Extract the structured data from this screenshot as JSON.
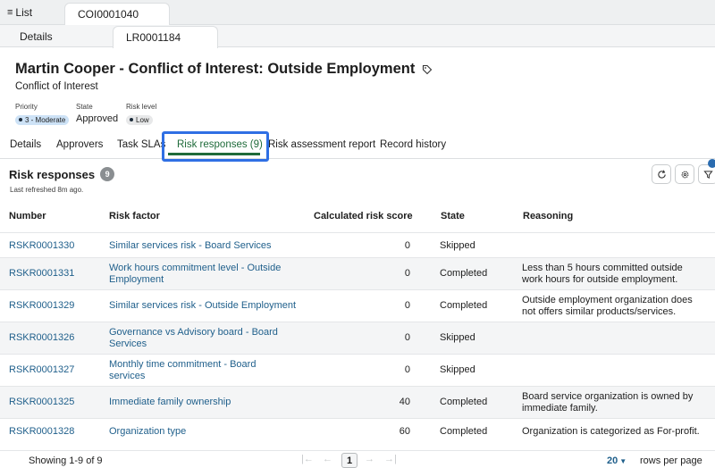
{
  "topbar": {
    "list_label": "List",
    "list_icon": "hamburger-icon",
    "record_tab": "COI0001040"
  },
  "subbar": {
    "details_tab": "Details",
    "record_tab": "LR0001184"
  },
  "header": {
    "title": "Martin Cooper - Conflict of Interest: Outside Employment",
    "subtitle": "Conflict of Interest",
    "fields": {
      "priority_label": "Priority",
      "priority_value": "3 - Moderate",
      "state_label": "State",
      "state_value": "Approved",
      "risk_label": "Risk level",
      "risk_value": "Low"
    }
  },
  "related_tabs": [
    "Details",
    "Approvers",
    "Task SLAs",
    "Risk responses (9)",
    "Risk assessment report",
    "Record history"
  ],
  "section": {
    "title": "Risk responses",
    "count": "9",
    "refreshed": "Last refreshed 8m ago."
  },
  "colors": {
    "link": "#1f5f8b",
    "active_tab": "#1f6b3a",
    "focus_ring": "#2f6fe4"
  },
  "table": {
    "headers": [
      "Number",
      "Risk factor",
      "Calculated risk score",
      "State",
      "Reasoning"
    ],
    "rows": [
      {
        "number": "RSKR0001330",
        "risk_factor": "Similar services risk - Board Services",
        "score": "0",
        "state": "Skipped",
        "reasoning": ""
      },
      {
        "number": "RSKR0001331",
        "risk_factor": "Work hours commitment level - Outside Employment",
        "score": "0",
        "state": "Completed",
        "reasoning": "Less than 5 hours committed outside work hours for outside employment."
      },
      {
        "number": "RSKR0001329",
        "risk_factor": "Similar services risk - Outside Employment",
        "score": "0",
        "state": "Completed",
        "reasoning": "Outside employment organization does not offers similar products/services."
      },
      {
        "number": "RSKR0001326",
        "risk_factor": "Governance vs Advisory board - Board Services",
        "score": "0",
        "state": "Skipped",
        "reasoning": ""
      },
      {
        "number": "RSKR0001327",
        "risk_factor": "Monthly time commitment - Board services",
        "score": "0",
        "state": "Skipped",
        "reasoning": ""
      },
      {
        "number": "RSKR0001325",
        "risk_factor": "Immediate family ownership",
        "score": "40",
        "state": "Completed",
        "reasoning": "Board service organization is owned by immediate family."
      },
      {
        "number": "RSKR0001328",
        "risk_factor": "Organization type",
        "score": "60",
        "state": "Completed",
        "reasoning": "Organization is categorized as For-profit."
      }
    ]
  },
  "footer": {
    "showing": "Showing 1-9 of 9",
    "current_page": "1",
    "rows_per_page_value": "20",
    "rows_per_page_label": "rows per page"
  }
}
